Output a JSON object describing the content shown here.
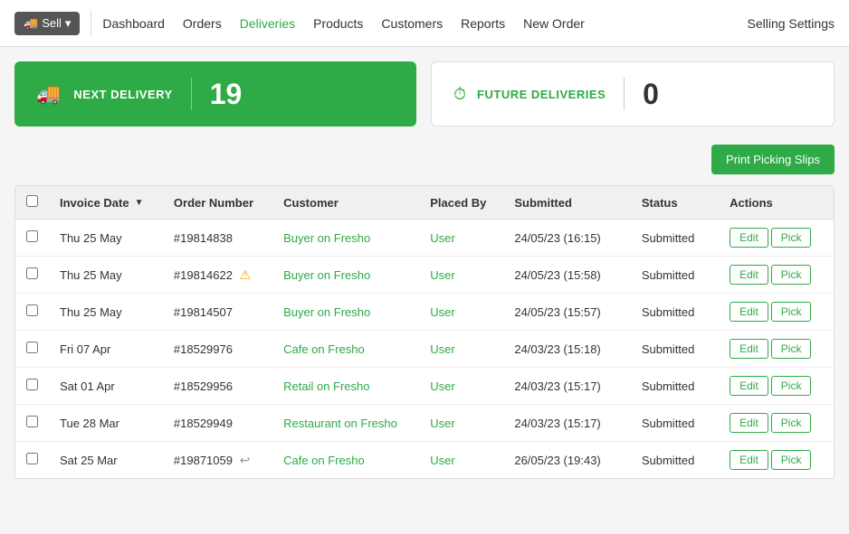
{
  "nav": {
    "sell_button": "Sell",
    "links": [
      {
        "label": "Dashboard",
        "active": false
      },
      {
        "label": "Orders",
        "active": false
      },
      {
        "label": "Deliveries",
        "active": true
      },
      {
        "label": "Products",
        "active": false
      },
      {
        "label": "Customers",
        "active": false
      },
      {
        "label": "Reports",
        "active": false
      },
      {
        "label": "New Order",
        "active": false
      }
    ],
    "settings": "Selling Settings"
  },
  "stats": {
    "next_delivery": {
      "label": "NEXT DELIVERY",
      "value": "19"
    },
    "future_deliveries": {
      "label": "FUTURE DELIVERIES",
      "value": "0"
    }
  },
  "toolbar": {
    "print_button": "Print Picking Slips"
  },
  "table": {
    "columns": [
      {
        "key": "checkbox",
        "label": ""
      },
      {
        "key": "invoice_date",
        "label": "Invoice Date",
        "sortable": true
      },
      {
        "key": "order_number",
        "label": "Order Number"
      },
      {
        "key": "customer",
        "label": "Customer"
      },
      {
        "key": "placed_by",
        "label": "Placed By"
      },
      {
        "key": "submitted",
        "label": "Submitted"
      },
      {
        "key": "status",
        "label": "Status"
      },
      {
        "key": "actions",
        "label": "Actions"
      }
    ],
    "rows": [
      {
        "invoice_date": "Thu 25 May",
        "order_number": "#19814838",
        "warning": false,
        "undo": false,
        "customer": "Buyer on Fresho",
        "placed_by": "User",
        "submitted": "24/05/23 (16:15)",
        "status": "Submitted",
        "actions": [
          "Edit",
          "Pick"
        ]
      },
      {
        "invoice_date": "Thu 25 May",
        "order_number": "#19814622",
        "warning": true,
        "undo": false,
        "customer": "Buyer on Fresho",
        "placed_by": "User",
        "submitted": "24/05/23 (15:58)",
        "status": "Submitted",
        "actions": [
          "Edit",
          "Pick"
        ]
      },
      {
        "invoice_date": "Thu 25 May",
        "order_number": "#19814507",
        "warning": false,
        "undo": false,
        "customer": "Buyer on Fresho",
        "placed_by": "User",
        "submitted": "24/05/23 (15:57)",
        "status": "Submitted",
        "actions": [
          "Edit",
          "Pick"
        ]
      },
      {
        "invoice_date": "Fri 07 Apr",
        "order_number": "#18529976",
        "warning": false,
        "undo": false,
        "customer": "Cafe on Fresho",
        "placed_by": "User",
        "submitted": "24/03/23 (15:18)",
        "status": "Submitted",
        "actions": [
          "Edit",
          "Pick"
        ]
      },
      {
        "invoice_date": "Sat 01 Apr",
        "order_number": "#18529956",
        "warning": false,
        "undo": false,
        "customer": "Retail on Fresho",
        "placed_by": "User",
        "submitted": "24/03/23 (15:17)",
        "status": "Submitted",
        "actions": [
          "Edit",
          "Pick"
        ]
      },
      {
        "invoice_date": "Tue 28 Mar",
        "order_number": "#18529949",
        "warning": false,
        "undo": false,
        "customer": "Restaurant on Fresho",
        "placed_by": "User",
        "submitted": "24/03/23 (15:17)",
        "status": "Submitted",
        "actions": [
          "Edit",
          "Pick"
        ]
      },
      {
        "invoice_date": "Sat 25 Mar",
        "order_number": "#19871059",
        "warning": false,
        "undo": true,
        "customer": "Cafe on Fresho",
        "placed_by": "User",
        "submitted": "26/05/23 (19:43)",
        "status": "Submitted",
        "actions": [
          "Edit",
          "Pick"
        ]
      }
    ]
  }
}
